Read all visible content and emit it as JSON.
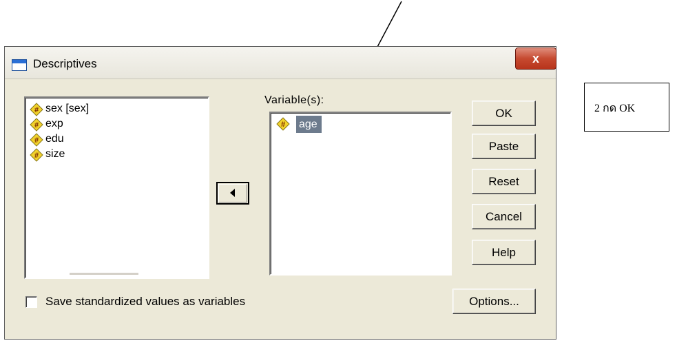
{
  "dialog": {
    "title": "Descriptives",
    "close_label": "x"
  },
  "source_list": {
    "items": [
      {
        "label": "sex [sex]",
        "icon": "scale-variable-icon"
      },
      {
        "label": "exp",
        "icon": "scale-variable-icon"
      },
      {
        "label": "edu",
        "icon": "scale-variable-icon"
      },
      {
        "label": "size",
        "icon": "scale-variable-icon"
      }
    ]
  },
  "target_list": {
    "caption": "Variable(s):",
    "items": [
      {
        "label": "age",
        "icon": "scale-variable-icon",
        "selected": true
      }
    ]
  },
  "buttons": {
    "ok": "OK",
    "paste": "Paste",
    "reset": "Reset",
    "cancel": "Cancel",
    "help": "Help",
    "options": "Options..."
  },
  "checkbox": {
    "label": "Save standardized values as variables",
    "checked": false
  },
  "annotation": {
    "text": "2 กด OK"
  },
  "colors": {
    "dialog_bg": "#ece9d8",
    "selection": "#6d7b8d",
    "close_button": "#c64a30",
    "variable_icon": "#f2d22b"
  }
}
